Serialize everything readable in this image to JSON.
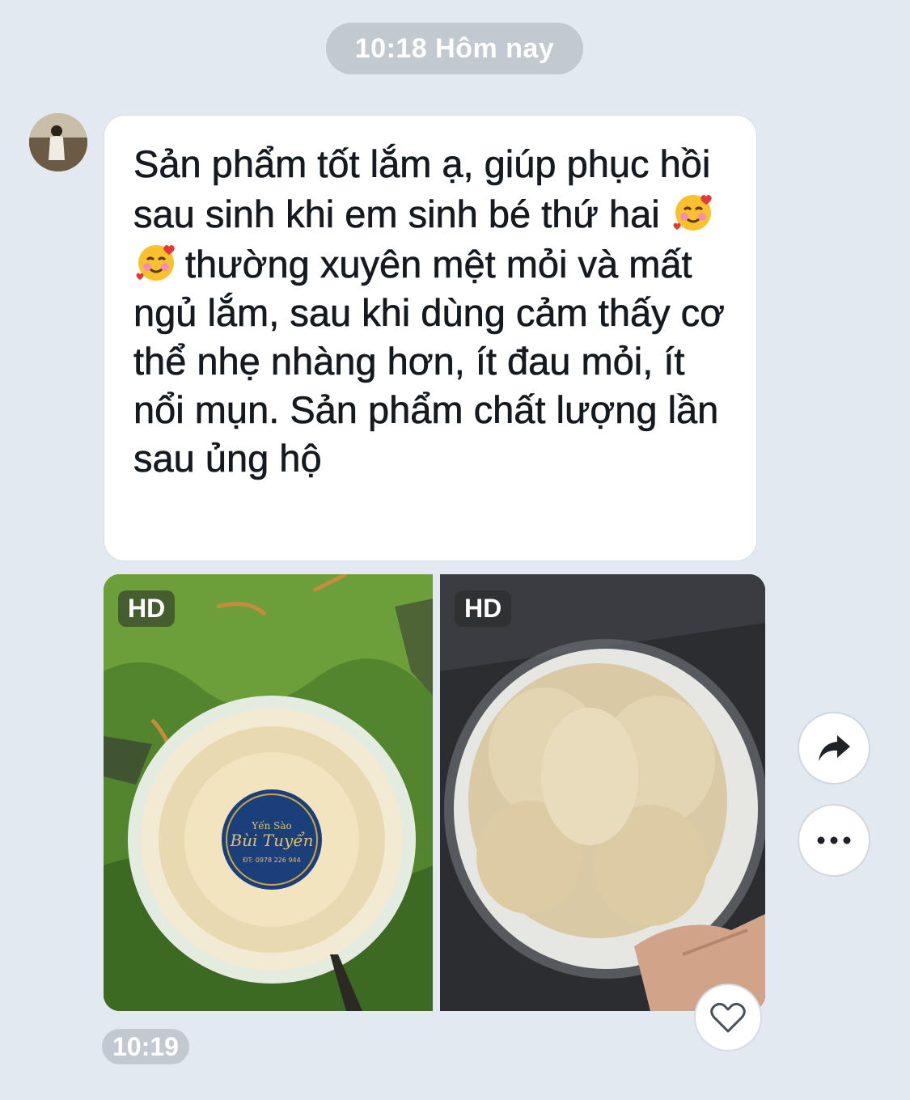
{
  "chat": {
    "date_separator": "10:18 Hôm nay",
    "message": {
      "text_part1": "Sản phẩm tốt lắm ạ, giúp phục hồi sau sinh khi em sinh bé thứ hai ",
      "text_part2": "thường xuyên mệt mỏi và mất ngủ lắm, sau khi dùng cảm thấy cơ thể nhẹ nhàng hơn, ít đau mỏi, ít nổi mụn. Sản phẩm chất lượng lần sau ủng hộ",
      "emojis": [
        "smiling-face-with-hearts",
        "smiling-face-with-hearts"
      ]
    },
    "photos": [
      {
        "badge": "HD",
        "label_brand": "Yến Sào",
        "label_name": "Bùi Tuyển",
        "label_phone": "ĐT: 0978 226 944"
      },
      {
        "badge": "HD"
      }
    ],
    "message_time": "10:19",
    "actions": [
      "share-icon",
      "more-icon",
      "heart-icon"
    ]
  }
}
